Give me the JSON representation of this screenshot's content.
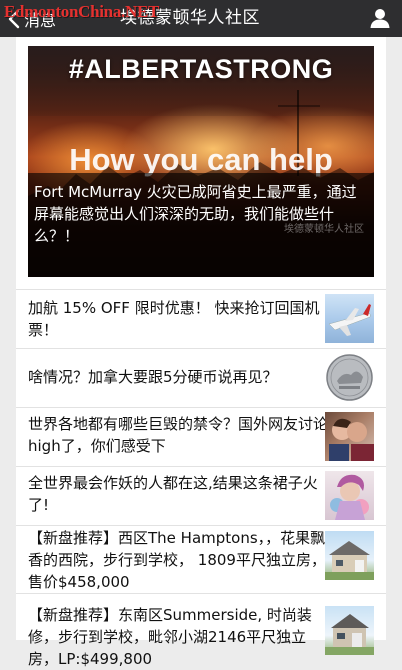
{
  "watermark": "EdmontonChina.NET",
  "header": {
    "back_label": "消息",
    "title": "埃德蒙顿华人社区"
  },
  "hero": {
    "image_hashtag": "#ALBERTASTRONG",
    "image_subtitle": "How you can help",
    "caption": "Fort McMurray 火灾已成阿省史上最严重，通过屏幕能感觉出人们深深的无助，我们能做些什么？！",
    "image_watermark": "埃德蒙顿华人社区"
  },
  "articles": [
    {
      "title": "加航 15% OFF 限时优惠！ 快来抢订回国机票！",
      "thumb": "airplane-image"
    },
    {
      "title": "啥情况？加拿大要跟5分硬币说再见？",
      "thumb": "nickel-coin-image"
    },
    {
      "title": "世界各地都有哪些巨毁的禁令？国外网友讨论high了，你们感受下",
      "thumb": "couple-kissing-image"
    },
    {
      "title": "全世界最会作妖的人都在这,结果这条裙子火了!",
      "thumb": "costume-person-image"
    },
    {
      "title": "【新盘推荐】西区The Hamptons，，花果飘香的西院，步行到学校， 1809平尺独立房，售价$458,000",
      "thumb": "house-image"
    },
    {
      "title": "【新盘推荐】东南区Summerside, 时尚装修，步行到学校，毗邻小湖2146平尺独立房，LP:$499,800",
      "thumb": "house-image"
    }
  ],
  "colors": {
    "topbar": "#2e2e30",
    "background": "#ececec",
    "card": "#ffffff",
    "watermark": "#e5312f"
  }
}
